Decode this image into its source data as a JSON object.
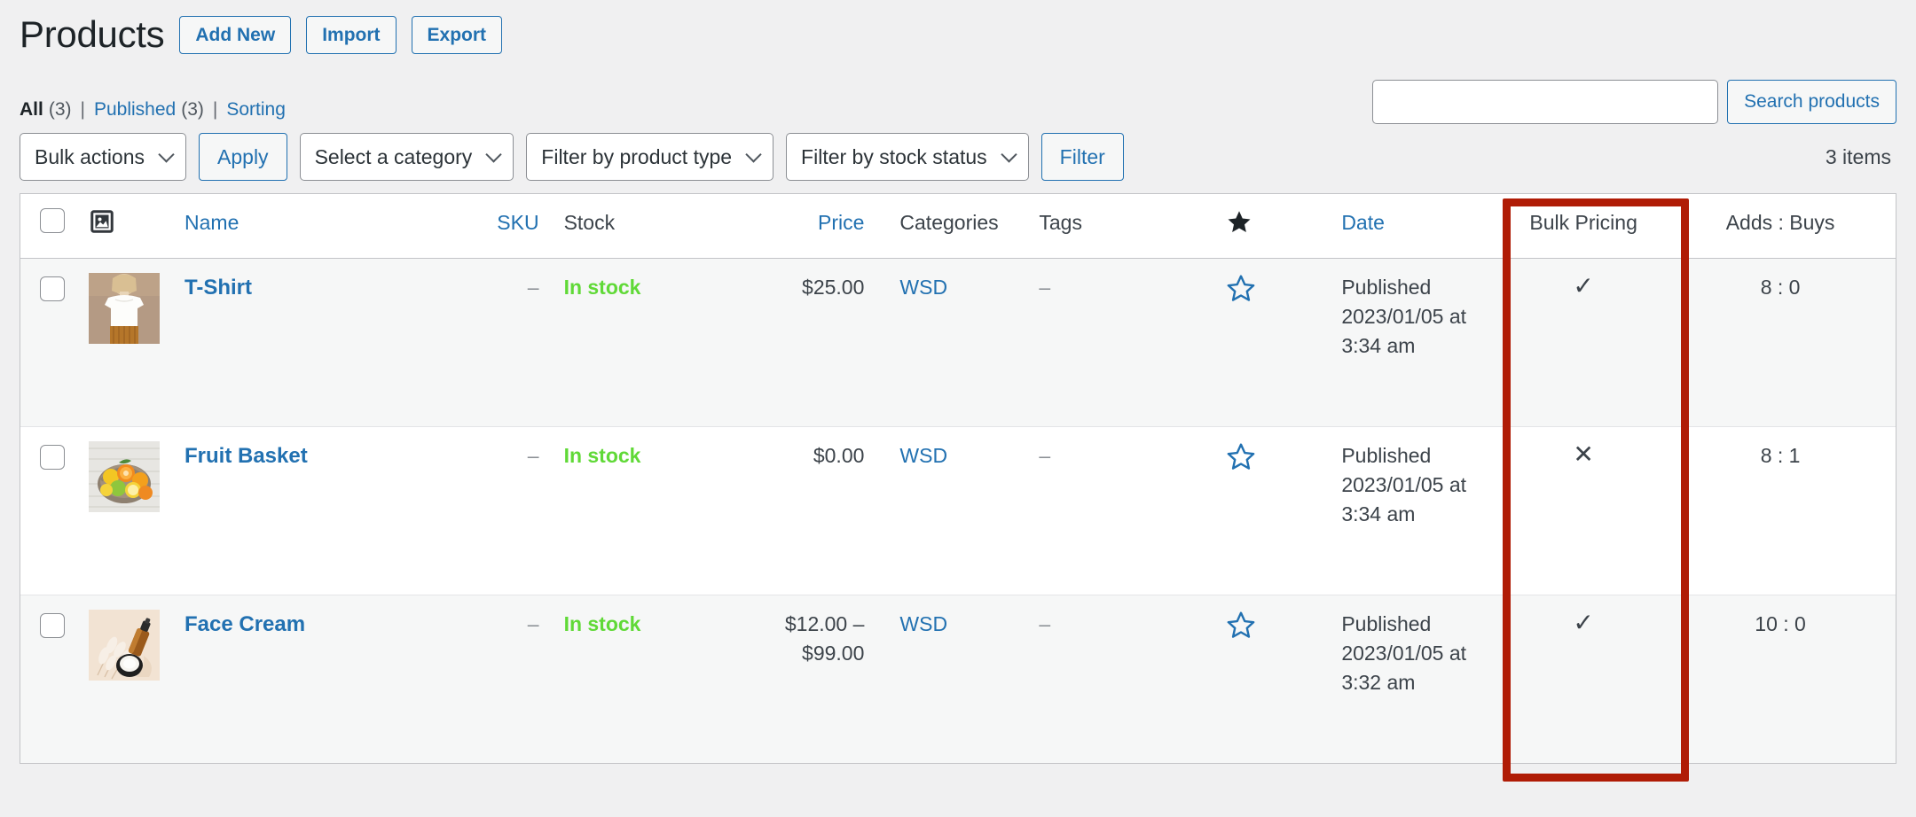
{
  "header": {
    "title": "Products",
    "buttons": [
      {
        "label": "Add New",
        "name": "add-new-button"
      },
      {
        "label": "Import",
        "name": "import-button"
      },
      {
        "label": "Export",
        "name": "export-button"
      }
    ]
  },
  "status_links": {
    "all_label": "All",
    "all_count": "(3)",
    "sep1": "|",
    "published_label": "Published",
    "published_count": "(3)",
    "sep2": "|",
    "sorting_label": "Sorting"
  },
  "search": {
    "value": "",
    "placeholder": "",
    "submit_label": "Search products"
  },
  "tablenav": {
    "bulk_actions_label": "Bulk actions",
    "apply_label": "Apply",
    "category_label": "Select a category",
    "product_type_label": "Filter by product type",
    "stock_status_label": "Filter by stock status",
    "filter_label": "Filter",
    "items_count": "3 items"
  },
  "table": {
    "columns": {
      "thumb_icon": "image-icon",
      "name": "Name",
      "sku": "SKU",
      "stock": "Stock",
      "price": "Price",
      "categories": "Categories",
      "tags": "Tags",
      "featured_icon": "star-filled-icon",
      "date": "Date",
      "bulk_pricing": "Bulk Pricing",
      "adds_buys": "Adds : Buys"
    },
    "rows": [
      {
        "thumb": "tshirt-thumbnail",
        "name": "T-Shirt",
        "sku": "–",
        "stock": "In stock",
        "price": "$25.00",
        "categories": "WSD",
        "tags": "–",
        "featured": "star-outline-icon",
        "date": "Published 2023/01/05 at 3:34 am",
        "bulk_pricing": "✓",
        "adds_buys": "8 : 0"
      },
      {
        "thumb": "fruit-basket-thumbnail",
        "name": "Fruit Basket",
        "sku": "–",
        "stock": "In stock",
        "price": "$0.00",
        "categories": "WSD",
        "tags": "–",
        "featured": "star-outline-icon",
        "date": "Published 2023/01/05 at 3:34 am",
        "bulk_pricing": "✕",
        "adds_buys": "8 : 1"
      },
      {
        "thumb": "face-cream-thumbnail",
        "name": "Face Cream",
        "sku": "–",
        "stock": "In stock",
        "price": "$12.00 – $99.00",
        "categories": "WSD",
        "tags": "–",
        "featured": "star-outline-icon",
        "date": "Published 2023/01/05 at 3:32 am",
        "bulk_pricing": "✓",
        "adds_buys": "10 : 0"
      }
    ]
  },
  "annotation": {
    "color": "#b01c06",
    "target_column": "Bulk Pricing"
  },
  "colors": {
    "link": "#2271b1",
    "in_stock": "#60d937",
    "page_bg": "#f0f0f1",
    "row_stripe": "#f6f7f7"
  }
}
